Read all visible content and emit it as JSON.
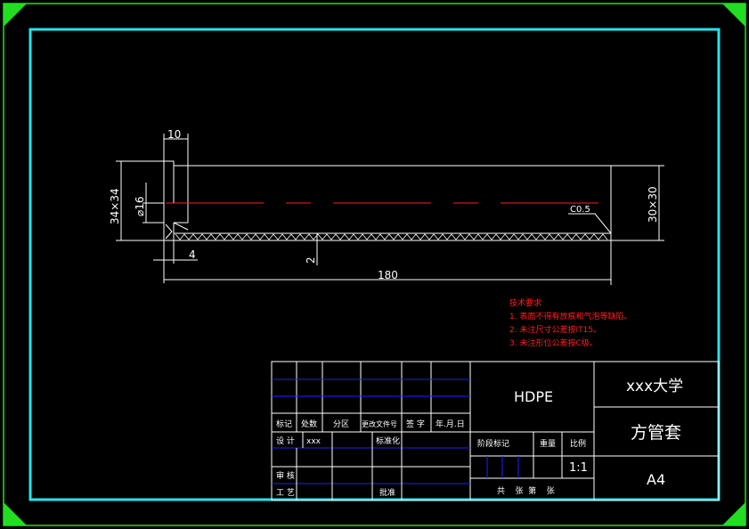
{
  "drawing": {
    "dimensions": {
      "top_width": "10",
      "diameter": "⌀16",
      "outer_square": "34×34",
      "inner_square": "30×30",
      "chamfer": "C0.5",
      "step": "4",
      "wall": "2",
      "length": "180"
    },
    "notes": {
      "title": "技术要求",
      "items": [
        "1. 表面不得有放痕和气泡等缺陷。",
        "2. 未注尺寸公差按IT15。",
        "3. 未注形位公差按C级。"
      ]
    }
  },
  "title_block": {
    "material": "HDPE",
    "school": "xxx大学",
    "part_name": "方管套",
    "sheet_size": "A4",
    "scale": "1:1",
    "designer": "xxx",
    "labels": {
      "mark": "标记",
      "count": "处数",
      "zone": "分区",
      "change_doc": "更改文件号",
      "signature": "签 字",
      "date": "年.月.日",
      "design": "设 计",
      "standardize": "标准化",
      "review": "审 核",
      "process": "工 艺",
      "approve": "批准",
      "stage_mark": "阶段标记",
      "weight": "重量",
      "ratio": "比例",
      "sheets": "共    张  第    张"
    }
  }
}
